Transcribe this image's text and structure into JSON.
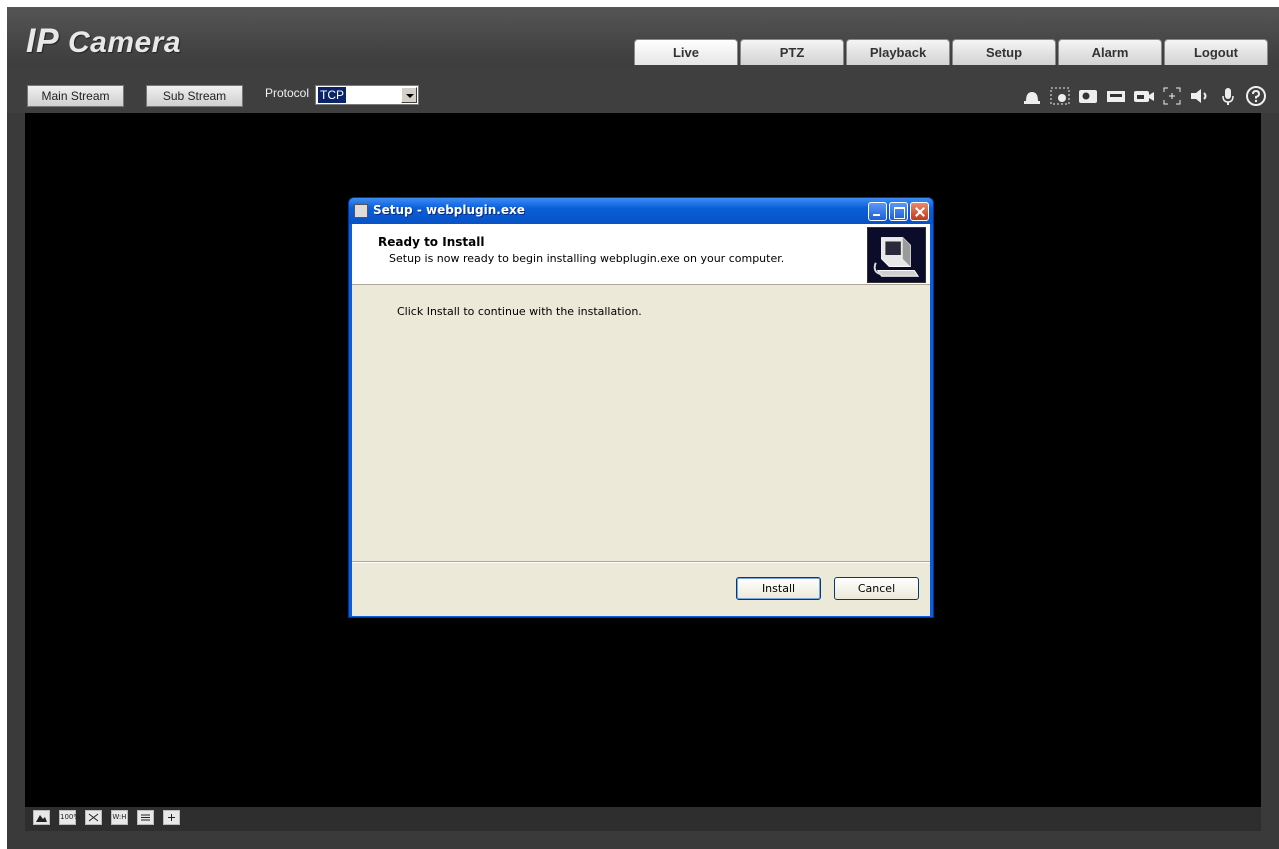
{
  "header": {
    "logo_ip": "IP",
    "logo_camera": "Camera",
    "tabs": [
      {
        "label": "Live"
      },
      {
        "label": "PTZ"
      },
      {
        "label": "Playback"
      },
      {
        "label": "Setup"
      },
      {
        "label": "Alarm"
      },
      {
        "label": "Logout"
      }
    ]
  },
  "toolbar": {
    "main_stream": "Main Stream",
    "sub_stream": "Sub Stream",
    "protocol_label": "Protocol",
    "protocol_value": "TCP",
    "icons": [
      "alarm-icon",
      "digital-zoom-icon",
      "snapshot-icon",
      "triple-snapshot-icon",
      "record-icon",
      "zoom-focus-icon",
      "audio-icon",
      "talk-icon",
      "help-icon"
    ]
  },
  "bottombar": {
    "icons": [
      "image-adjust-icon",
      "original-size-icon",
      "fullscreen-icon",
      "wh-ratio-icon",
      "fluency-icon",
      "rule-icon"
    ],
    "original_size_text": "100%",
    "wh_text": "W:H"
  },
  "dialog": {
    "title": "Setup - webplugin.exe",
    "heading": "Ready to Install",
    "subheading": "Setup is now ready to begin installing webplugin.exe on your computer.",
    "message": "Click Install to continue with the installation.",
    "install_label": "Install",
    "cancel_label": "Cancel"
  },
  "colors": {
    "accent": "#0a5fd8",
    "background": "#3a3a3a",
    "video": "#000000"
  }
}
